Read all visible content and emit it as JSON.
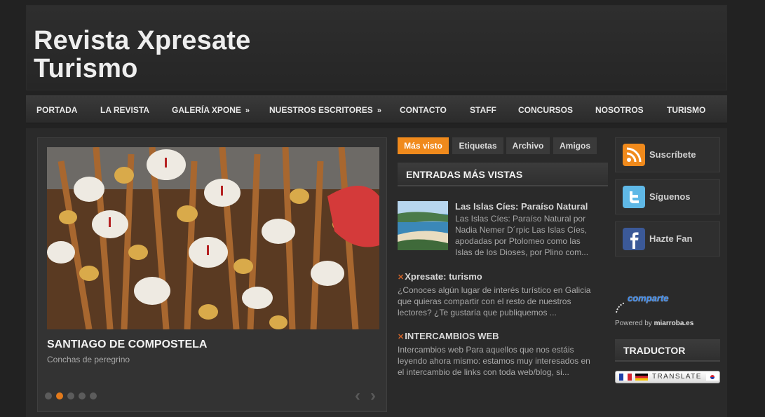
{
  "site": {
    "title_line1": "Revista Xpresate",
    "title_line2": "Turismo"
  },
  "nav": {
    "items": [
      {
        "label": "PORTADA"
      },
      {
        "label": "LA REVISTA"
      },
      {
        "label": "GALERÍA XPONE",
        "submenu": "»"
      },
      {
        "label": "NUESTROS ESCRITORES",
        "submenu": "»"
      },
      {
        "label": "CONTACTO"
      },
      {
        "label": "STAFF"
      },
      {
        "label": "CONCURSOS"
      },
      {
        "label": "NOSOTROS"
      },
      {
        "label": "TURISMO"
      }
    ]
  },
  "slider": {
    "title": "SANTIAGO DE COMPOSTELA",
    "caption": "Conchas de peregrino",
    "active_dot": 2,
    "dot_count": 5,
    "prev_glyph": "‹",
    "next_glyph": "›"
  },
  "tabs": [
    {
      "label": "Más visto",
      "active": true
    },
    {
      "label": "Etiquetas",
      "active": false
    },
    {
      "label": "Archivo",
      "active": false
    },
    {
      "label": "Amigos",
      "active": false
    }
  ],
  "entries": {
    "header": "ENTRADAS MÁS VISTAS",
    "posts": [
      {
        "title": "Las Islas Cíes: Paraíso Natural",
        "lines": [
          "Las Islas Cíes: Paraíso Natural por",
          "Nadia Nemer D´rpic Las Islas Cíes,",
          "apodadas por Ptolomeo como las",
          "Islas de los Dioses, por Plino com..."
        ]
      },
      {
        "title": "Xpresate: turismo",
        "lines": [
          "¿Conoces algún lugar de interés turístico en Galicia",
          "que quieras compartir con el resto de nuestros",
          "lectores? ¿Te gustaría que publiquemos ..."
        ]
      },
      {
        "title": "INTERCAMBIOS WEB",
        "lines": [
          "Intercambios web Para aquellos que nos estáis",
          "leyendo ahora mismo: estamos muy interesados en",
          "el intercambio de links con toda web/blog, si..."
        ]
      }
    ]
  },
  "social": [
    {
      "label": "Suscríbete",
      "icon": "rss-icon",
      "color": "#f08a1c"
    },
    {
      "label": "Síguenos",
      "icon": "twitter-icon",
      "color": "#5fb8e6"
    },
    {
      "label": "Hazte Fan",
      "icon": "facebook-icon",
      "color": "#3b5998"
    }
  ],
  "share": {
    "label": "comparte",
    "powered_prefix": "Powered by",
    "powered_brand": "miarroba.es"
  },
  "traductor": {
    "header": "TRADUCTOR",
    "translate_label": "TRANSLATE"
  },
  "colors": {
    "accent": "#f08a1c",
    "background": "#222222"
  }
}
